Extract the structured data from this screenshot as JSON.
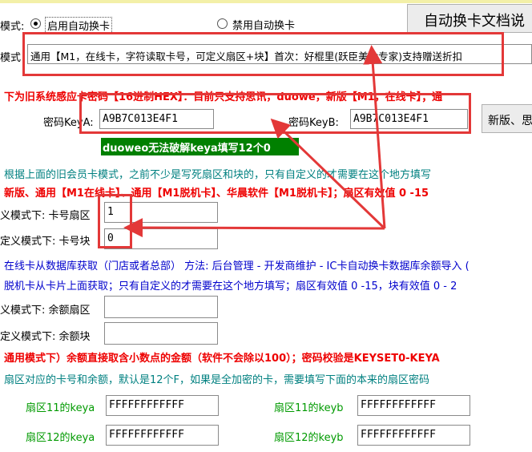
{
  "top": {
    "mode_label": "模式:",
    "radio_enable": "启用自动换卡",
    "radio_disable": "禁用自动换卡",
    "doc_button": "自动换卡文档说",
    "mode2_label": "模式",
    "mode_value": "通用【M1，在线卡，字符读取卡号，可定义扇区+块】首次：好棍里(跃臣美食专家)支持赠送折扣"
  },
  "legacy": {
    "notice": "下为旧系统感应卡密码【16进制HEX】：目前只支持思讯，duowe，新版【M1，在线卡】；通",
    "keya_label": "密码KeyA:",
    "keya_value": "A9B7C013E4F1",
    "keyb_label": "密码KeyB:",
    "keyb_value": "A9B7C013E4F1",
    "new_button": "新版、思",
    "duoweo_badge": "duoweo无法破解keya填写12个0"
  },
  "custom": {
    "info1": "根据上面的旧会员卡模式，之前不少是写死扇区和块的，只有自定义的才需要在这个地方填写",
    "info2": "新版、通用【M1在线卡】、通用【M1脱机卡】、华晨软件【M1脱机卡】；扇区有效值 0 -15",
    "sector_label": "义模式下: 卡号扇区",
    "sector_value": "1",
    "block_label": "定义模式下: 卡号块",
    "block_value": "0"
  },
  "balance": {
    "online_info": "在线卡从数据库获取（门店或者总部） 方法: 后台管理 - 开发商维护 - IC卡自动换卡数据库余额导入 (",
    "offline_info": "脱机卡从卡片上面获取；只有自定义的才需要在这个地方填写；扇区有效值 0 -15，块有效值 0 - 2",
    "sector_label": "义模式下: 余额扇区",
    "sector_value": "",
    "block_label": "定义模式下: 余额块",
    "block_value": ""
  },
  "amount": {
    "notice": "通用模式下）余额直接取含小数点的金额（软件不会除以100）；密码校验是KEYSET0-KEYA",
    "info": "扇区对应的卡号和余额，默认是12个F，如果是全加密的卡，需要填写下面的本来的扇区密码"
  },
  "keys": {
    "s11a_label": "扇区11的keya",
    "s11a_value": "FFFFFFFFFFFF",
    "s11b_label": "扇区11的keyb",
    "s11b_value": "FFFFFFFFFFFF",
    "s12a_label": "扇区12的keya",
    "s12a_value": "FFFFFFFFFFFF",
    "s12b_label": "扇区12的keyb",
    "s12b_value": "FFFFFFFFFFFF"
  },
  "colors": {
    "annotation": "#e33838",
    "badge": "#008000",
    "notice_red": "#ee0000"
  }
}
